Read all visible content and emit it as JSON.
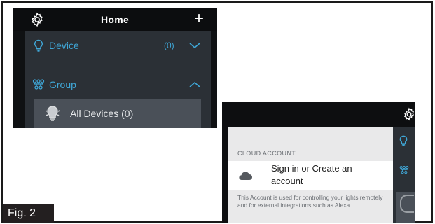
{
  "figure": {
    "label": "Fig. 2"
  },
  "screen1": {
    "header": {
      "title": "Home",
      "left_icon": "gear-icon",
      "right_icon": "plus-icon",
      "plus_glyph": "+"
    },
    "rows": {
      "device": {
        "label": "Device",
        "count": "(0)",
        "icon": "lightbulb-icon",
        "chevron": "chevron-down-icon"
      },
      "group": {
        "label": "Group",
        "icon": "group-nodes-icon",
        "chevron": "chevron-up-icon"
      }
    },
    "group_item": {
      "label": "All Devices (0)",
      "icon": "bulb-icon"
    },
    "colors": {
      "accent": "#3fa6d6",
      "background": "#0f1113",
      "panel": "#2b3036",
      "item": "#4a5058"
    }
  },
  "screen2": {
    "section_label": "CLOUD ACCOUNT",
    "signin": {
      "text": "Sign in or Create an account",
      "icon": "cloud-icon"
    },
    "description": "This Account is used for controlling your lights remotely and for external integrations such as Alexa.",
    "sidebar_icons": [
      "gear-icon",
      "lightbulb-icon",
      "group-nodes-icon",
      "bulb-icon"
    ]
  }
}
